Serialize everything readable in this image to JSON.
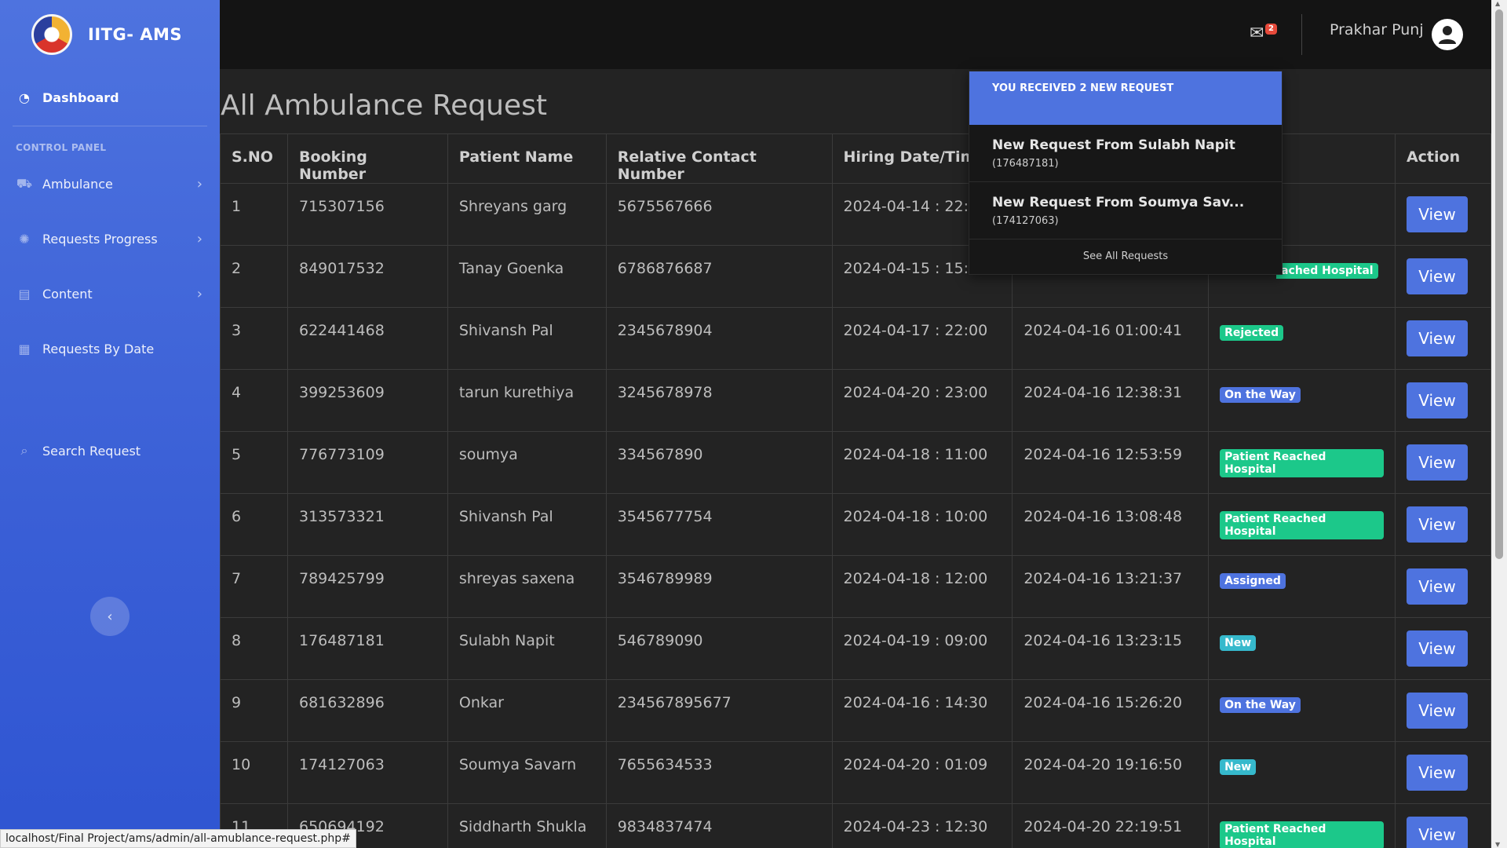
{
  "sidebar": {
    "brand": "IITG- AMS",
    "dashboard": "Dashboard",
    "section": "CONTROL PANEL",
    "items": [
      {
        "label": "Ambulance"
      },
      {
        "label": "Requests Progress"
      },
      {
        "label": "Content"
      },
      {
        "label": "Requests By Date"
      },
      {
        "label": "Search Request"
      }
    ]
  },
  "topbar": {
    "notif_count": "2",
    "user_name": "Prakhar Punj"
  },
  "page": {
    "title": "All Ambulance Request"
  },
  "table": {
    "headers": [
      "S.NO",
      "Booking Number",
      "Patient Name",
      "Relative Contact Number",
      "Hiring Date/Time",
      "",
      "",
      "Action"
    ],
    "rows": [
      {
        "sno": "1",
        "booking": "715307156",
        "patient": "Shreyans garg",
        "contact": "5675567666",
        "hiring": "2024-04-14 : 22:",
        "created": "",
        "status": "",
        "action": "View"
      },
      {
        "sno": "2",
        "booking": "849017532",
        "patient": "Tanay Goenka",
        "contact": "6786876687",
        "hiring": "2024-04-15 : 15:",
        "created": "",
        "status": "ached Hospital",
        "action": "View"
      },
      {
        "sno": "3",
        "booking": "622441468",
        "patient": "Shivansh Pal",
        "contact": "2345678904",
        "hiring": "2024-04-17 : 22:00",
        "created": "2024-04-16 01:00:41",
        "status": "Rejected",
        "action": "View"
      },
      {
        "sno": "4",
        "booking": "399253609",
        "patient": "tarun kurethiya",
        "contact": "3245678978",
        "hiring": "2024-04-20 : 23:00",
        "created": "2024-04-16 12:38:31",
        "status": "On the Way",
        "action": "View"
      },
      {
        "sno": "5",
        "booking": "776773109",
        "patient": "soumya",
        "contact": "334567890",
        "hiring": "2024-04-18 : 11:00",
        "created": "2024-04-16 12:53:59",
        "status": "Patient Reached Hospital",
        "action": "View"
      },
      {
        "sno": "6",
        "booking": "313573321",
        "patient": "Shivansh Pal",
        "contact": "3545677754",
        "hiring": "2024-04-18 : 10:00",
        "created": "2024-04-16 13:08:48",
        "status": "Patient Reached Hospital",
        "action": "View"
      },
      {
        "sno": "7",
        "booking": "789425799",
        "patient": "shreyas saxena",
        "contact": "3546789989",
        "hiring": "2024-04-18 : 12:00",
        "created": "2024-04-16 13:21:37",
        "status": "Assigned",
        "action": "View"
      },
      {
        "sno": "8",
        "booking": "176487181",
        "patient": "Sulabh Napit",
        "contact": "546789090",
        "hiring": "2024-04-19 : 09:00",
        "created": "2024-04-16 13:23:15",
        "status": "New",
        "action": "View"
      },
      {
        "sno": "9",
        "booking": "681632896",
        "patient": "Onkar",
        "contact": "234567895677",
        "hiring": "2024-04-16 : 14:30",
        "created": "2024-04-16 15:26:20",
        "status": "On the Way",
        "action": "View"
      },
      {
        "sno": "10",
        "booking": "174127063",
        "patient": "Soumya Savarn",
        "contact": "7655634533",
        "hiring": "2024-04-20 : 01:09",
        "created": "2024-04-20 19:16:50",
        "status": "New",
        "action": "View"
      },
      {
        "sno": "11",
        "booking": "650694192",
        "patient": "Siddharth Shukla",
        "contact": "9834837474",
        "hiring": "2024-04-23 : 12:30",
        "created": "2024-04-20 22:19:51",
        "status": "Patient Reached Hospital",
        "action": "View"
      }
    ]
  },
  "dropdown": {
    "header": "YOU RECEIVED 2 NEW REQUEST",
    "items": [
      {
        "title": "New Request From Sulabh Napit",
        "sub": "(176487181)"
      },
      {
        "title": "New Request From Soumya Sav...",
        "sub": "(174127063)"
      }
    ],
    "footer": "See All Requests"
  },
  "status_url": "localhost/Final Project/ams/admin/all-amublance-request.php#",
  "colors": {
    "sidebar": "#4e73df",
    "primary": "#4e73df",
    "success": "#1cc88a",
    "info": "#36b9cc",
    "notif_badge": "#e74a3b"
  }
}
